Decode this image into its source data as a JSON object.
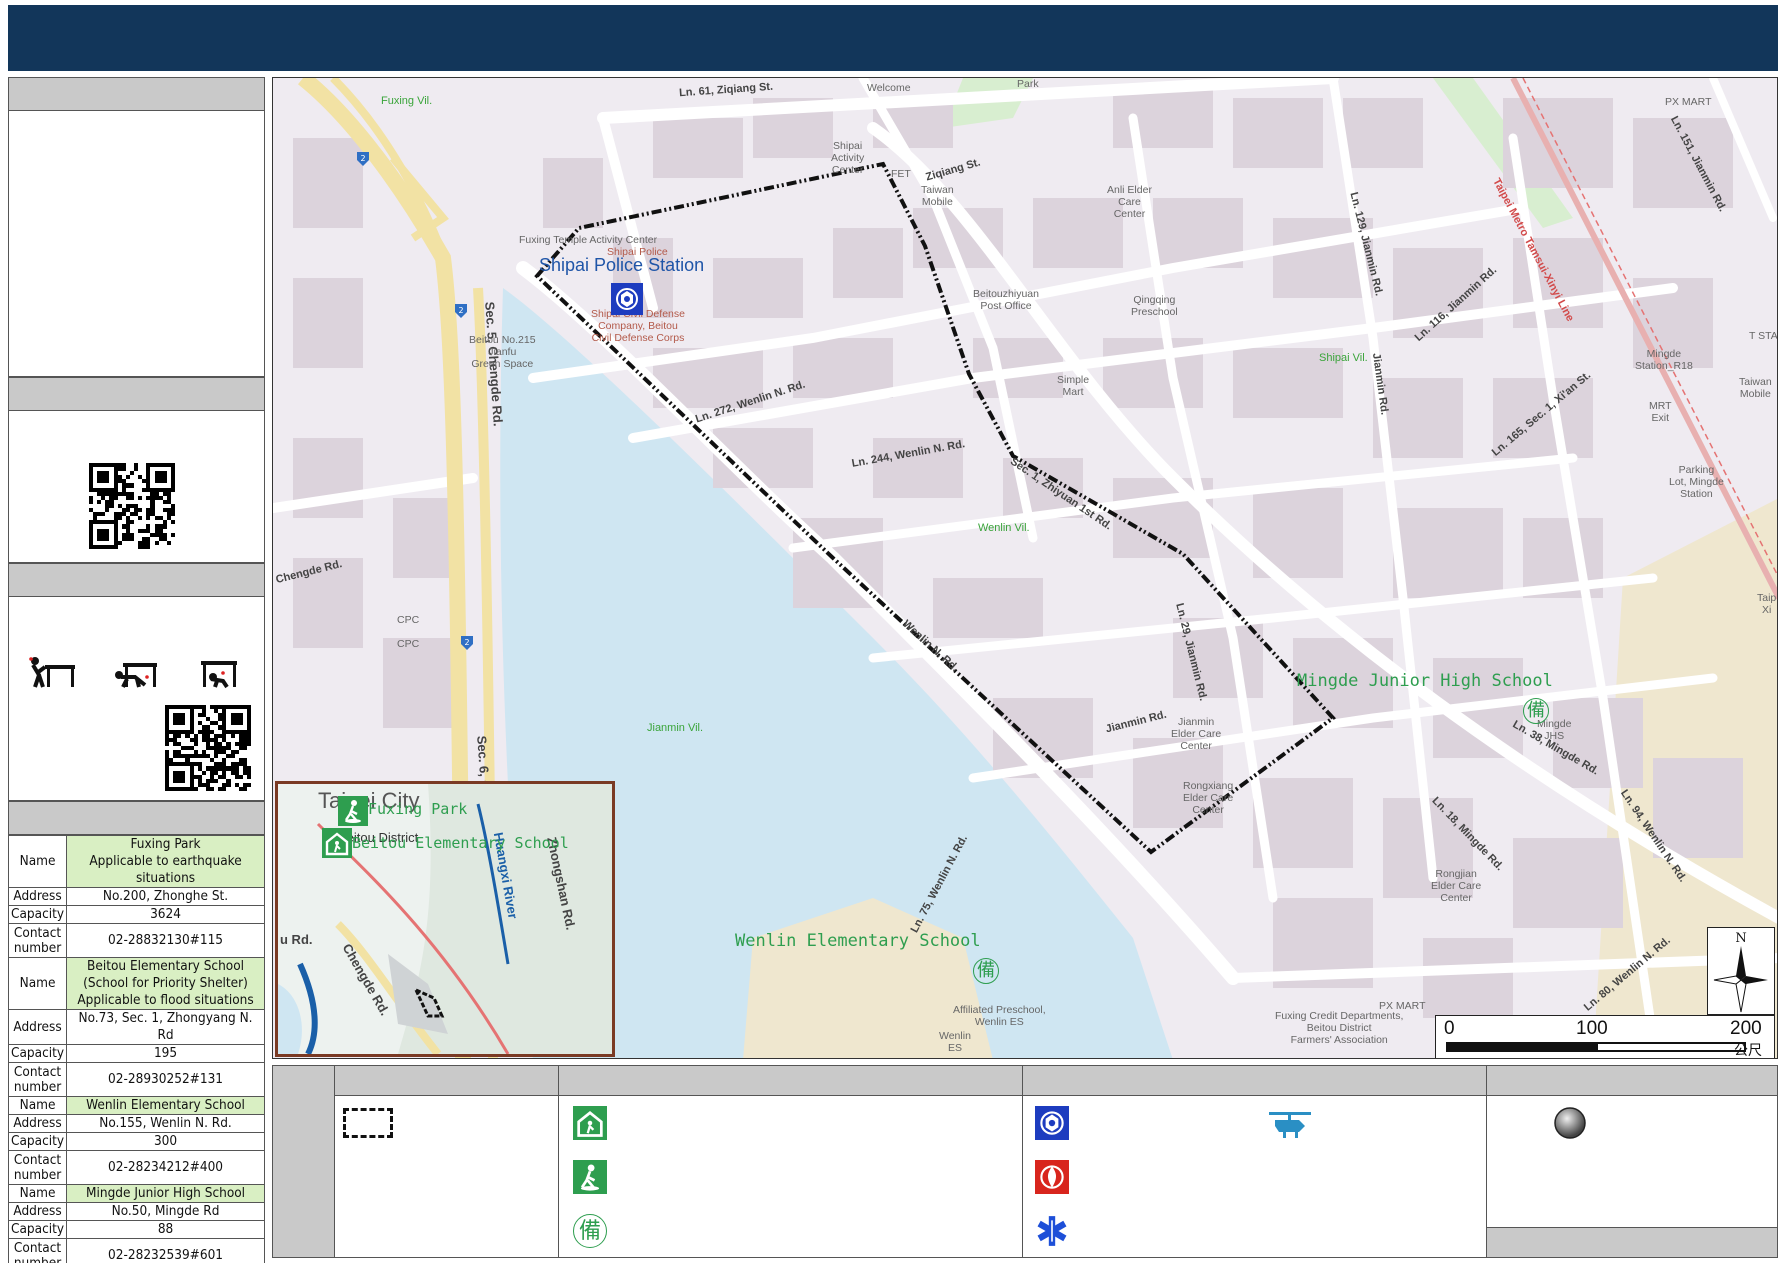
{
  "map": {
    "villages": {
      "fuxing": "Fuxing Vil.",
      "shipai": "Shipai Vil.",
      "wenlin": "Wenlin Vil.",
      "jianmin": "Jianmin Vil."
    },
    "roads": {
      "ziqiang61": "Ln. 61, Ziqiang St.",
      "ziqiang": "Ziqiang St.",
      "wenlin272": "Ln. 272, Wenlin N. Rd.",
      "wenlin244": "Ln. 244, Wenlin N. Rd.",
      "wenlin_n": "Wenlin N. Rd.",
      "chengde": "Chengde Rd.",
      "chengde_sec5": "Sec. 5, Chengde Rd.",
      "chengde_sec6": "Sec. 6, Chengde Rd.",
      "jianmin": "Jianmin Rd.",
      "jianmin_ln29": "Ln. 29, Jianmin Rd.",
      "jianmin_ln129": "Ln. 129, Jianmin Rd.",
      "jianmin_ln116": "Ln. 116, Jianmin Rd.",
      "jianmin_ln151": "Ln. 151, Jianmin Rd.",
      "jianmin_v": "Jianmin Rd.",
      "xian165": "Ln. 165, Sec. 1, Xi'an St.",
      "mingde38": "Ln. 38, Mingde Rd.",
      "mingde18": "Ln. 18, Mingde Rd.",
      "wenlin94": "Ln. 94, Wenlin N. Rd.",
      "wenlin75": "Ln. 75, Wenlin N. Rd.",
      "wenlin80": "Ln. 80, Wenlin N. Rd.",
      "zhiyuan": "Sec. 1, Zhiyuan 1st Rd.",
      "metro": "Taipei Metro Tamsui-Xinyi Line"
    },
    "pois": {
      "welcome": "Welcome",
      "park": "Park",
      "shipai_activity": "Shipai\nActivity\nCenter",
      "fet": "FET",
      "taiwan_mobile": "Taiwan\nMobile",
      "anli": "Anli Elder\nCare\nCenter",
      "px_mart_top": "PX MART",
      "fuxing_temple": "Fuxing Temple Activity Center",
      "shipai_police_small": "Shipai Police",
      "civil_defense": "Shipai Civil Defense\nCompany, Beitou\nCivil Defense Corps",
      "beitou_green": "Beitou No.215\nJianfu\nGreen Space",
      "post_office": "Beitouzhiyuan\nPost Office",
      "qingqing": "Qingqing\nPreschool",
      "simple_mart": "Simple\nMart",
      "mingde_station": "Mingde\nStation_R18",
      "mrt_exit": "MRT\nExit",
      "parking": "Parking\nLot, Mingde\nStation",
      "taiwan_mobile_r": "Taiwan\nMobile",
      "tsta": "T STA",
      "cpc": "CPC\n\nCPC",
      "jianmin_elder": "Jianmin\nElder Care\nCenter",
      "rongxiang": "Rongxiang\nElder Care\nCenter",
      "mingde_jhs": "Mingde\nJHS",
      "rongjian": "Rongjian\nElder Care\nCenter",
      "px_mart_bottom": "PX MART",
      "fuxing_credit": "Fuxing Credit Departments,\nBeitou District\nFarmers' Association",
      "affiliated": "Affiliated Preschool,\nWenlin ES",
      "wenlin_es": "Wenlin\nES",
      "taipei_xi": "Taip\nXi"
    },
    "landmarks": {
      "police": "Shipai Police Station",
      "mingde_school": "Mingde Junior High School",
      "wenlin_school": "Wenlin Elementary School"
    },
    "bei": "備",
    "highway_shields": [
      "2",
      "2",
      "2",
      "2"
    ],
    "inset": {
      "city": "Taipei City",
      "district": "Beitou District",
      "river": "Huangxi River",
      "road1": "Chengde Rd.",
      "road2": "Zhongshan Rd.",
      "road3": "u Rd.",
      "shelter1": "Fuxing Park",
      "shelter2": "Beitou Elementary School"
    },
    "compass_label": "N",
    "scale": {
      "t0": "0",
      "t1": "100",
      "t2": "200",
      "unit": "公尺"
    }
  },
  "shelters": {
    "name_label": "Name",
    "address_label": "Address",
    "capacity_label": "Capacity",
    "contact_label": "Contact number",
    "items": [
      {
        "name": "Fuxing Park\nApplicable to earthquake situations",
        "address": "No.200, Zhonghe St.",
        "capacity": "3624",
        "contact": "02-28832130#115"
      },
      {
        "name": "Beitou Elementary School\n(School for Priority Shelter)\nApplicable to flood situations",
        "address": "No.73, Sec. 1, Zhongyang N. Rd",
        "capacity": "195",
        "contact": "02-28930252#131"
      },
      {
        "name": "Wenlin Elementary School",
        "address": "No.155, Wenlin N. Rd.",
        "capacity": "300",
        "contact": "02-28234212#400"
      },
      {
        "name": "Mingde Junior High School",
        "address": "No.50, Mingde Rd",
        "capacity": "88",
        "contact": "02-28232539#601"
      }
    ]
  },
  "legend": {
    "bei": "備"
  },
  "colors": {
    "header": "#12365a",
    "panel_gray": "#c9c9c9",
    "shelter_green": "#d9efc3",
    "water": "#cfe6f2",
    "block": "#dcd3dc",
    "police_blue": "#1d3cbf",
    "fire_red": "#d8251d",
    "school_green": "#2e9e4f"
  }
}
